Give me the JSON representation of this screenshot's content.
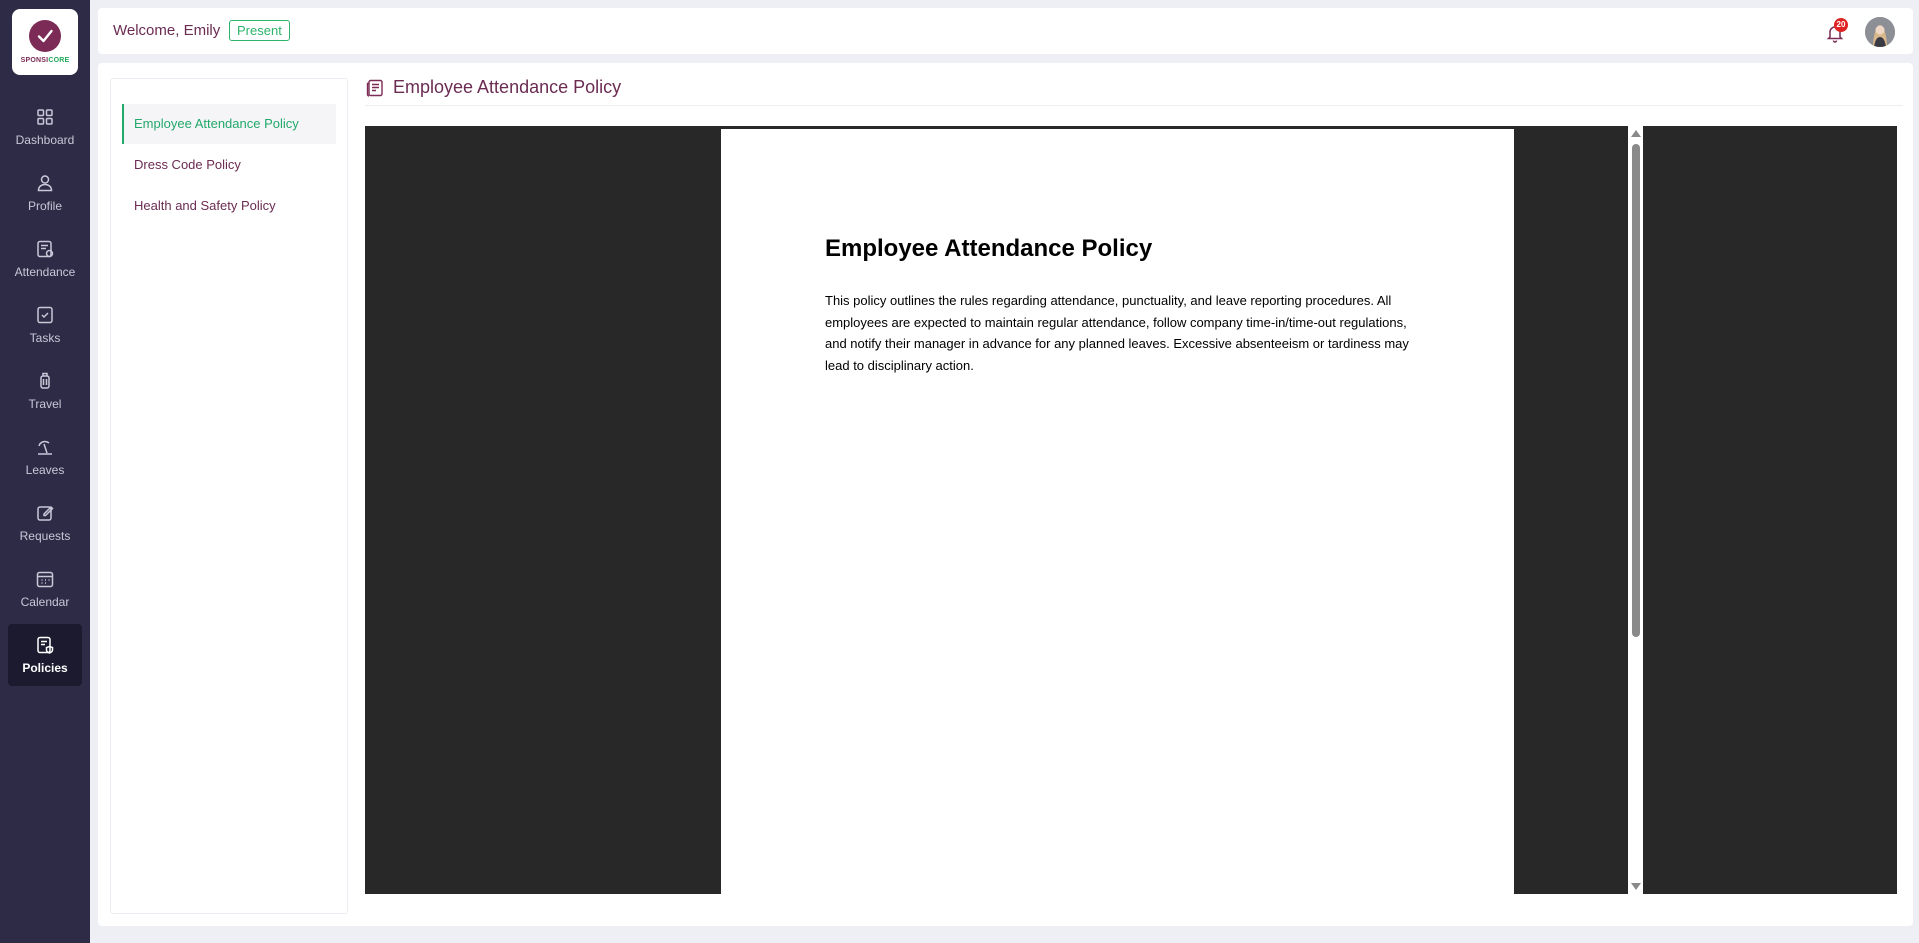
{
  "brand": {
    "logo_text_part1": "SPONSI",
    "logo_text_part2": "CORE",
    "primary_color": "#7b2b55",
    "accent_color": "#22a85a",
    "sidebar_color": "#2e2b46"
  },
  "sidebar": {
    "items": [
      {
        "label": "Dashboard",
        "icon": "grid-icon"
      },
      {
        "label": "Profile",
        "icon": "user-icon"
      },
      {
        "label": "Attendance",
        "icon": "attendance-icon"
      },
      {
        "label": "Tasks",
        "icon": "tasks-icon"
      },
      {
        "label": "Travel",
        "icon": "luggage-icon"
      },
      {
        "label": "Leaves",
        "icon": "beach-icon"
      },
      {
        "label": "Requests",
        "icon": "edit-icon"
      },
      {
        "label": "Calendar",
        "icon": "calendar-icon"
      },
      {
        "label": "Policies",
        "icon": "policy-icon",
        "active": true
      }
    ]
  },
  "header": {
    "welcome": "Welcome, Emily",
    "status": "Present",
    "notification_count": "20"
  },
  "policies": {
    "items": [
      {
        "label": "Employee Attendance Policy",
        "active": true
      },
      {
        "label": "Dress Code Policy"
      },
      {
        "label": "Health and Safety Policy"
      }
    ]
  },
  "document": {
    "title": "Employee Attendance Policy",
    "heading": "Employee Attendance Policy",
    "body": "This policy outlines the rules regarding attendance, punctuality, and leave reporting procedures. All employees are expected to maintain regular attendance, follow company time-in/time-out regulations, and notify their manager in advance for any planned leaves. Excessive absenteeism or tardiness may lead to disciplinary action."
  }
}
